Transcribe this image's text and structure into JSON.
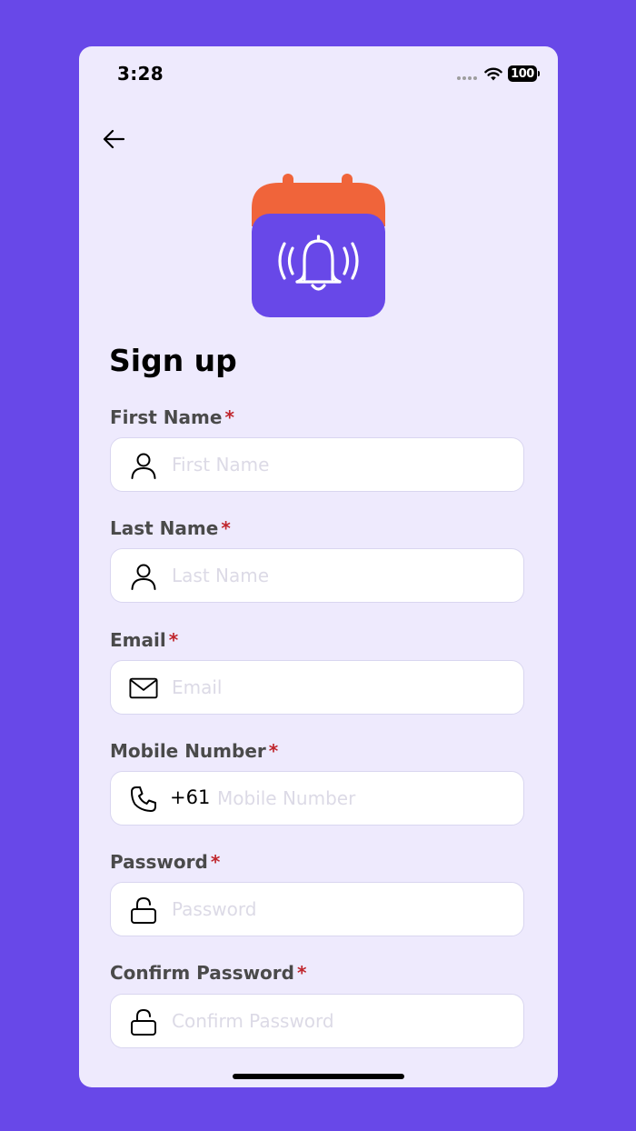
{
  "status_bar": {
    "time": "3:28",
    "battery": "100"
  },
  "title": "Sign up",
  "fields": {
    "first_name": {
      "label": "First Name",
      "required": "*",
      "placeholder": "First Name",
      "value": ""
    },
    "last_name": {
      "label": "Last Name",
      "required": "*",
      "placeholder": "Last Name",
      "value": ""
    },
    "email": {
      "label": "Email",
      "required": "*",
      "placeholder": "Email",
      "value": ""
    },
    "mobile": {
      "label": "Mobile Number",
      "required": "*",
      "country_code": "+61",
      "placeholder": "Mobile Number",
      "value": ""
    },
    "password": {
      "label": "Password",
      "required": "*",
      "placeholder": "Password",
      "value": ""
    },
    "confirm_password": {
      "label": "Confirm Password",
      "required": "*",
      "placeholder": "Confirm Password",
      "value": ""
    }
  },
  "icons": {
    "back": "arrow-left-icon",
    "logo": "calendar-bell-icon",
    "first_name": "user-icon",
    "last_name": "user-icon",
    "email": "mail-icon",
    "mobile": "phone-icon",
    "password": "unlock-icon",
    "confirm_password": "unlock-icon"
  },
  "colors": {
    "background": "#6848E8",
    "screen": "#EEEAFD",
    "accent": "#6848E8",
    "logo_top": "#F0643A",
    "required": "#C0262D"
  }
}
